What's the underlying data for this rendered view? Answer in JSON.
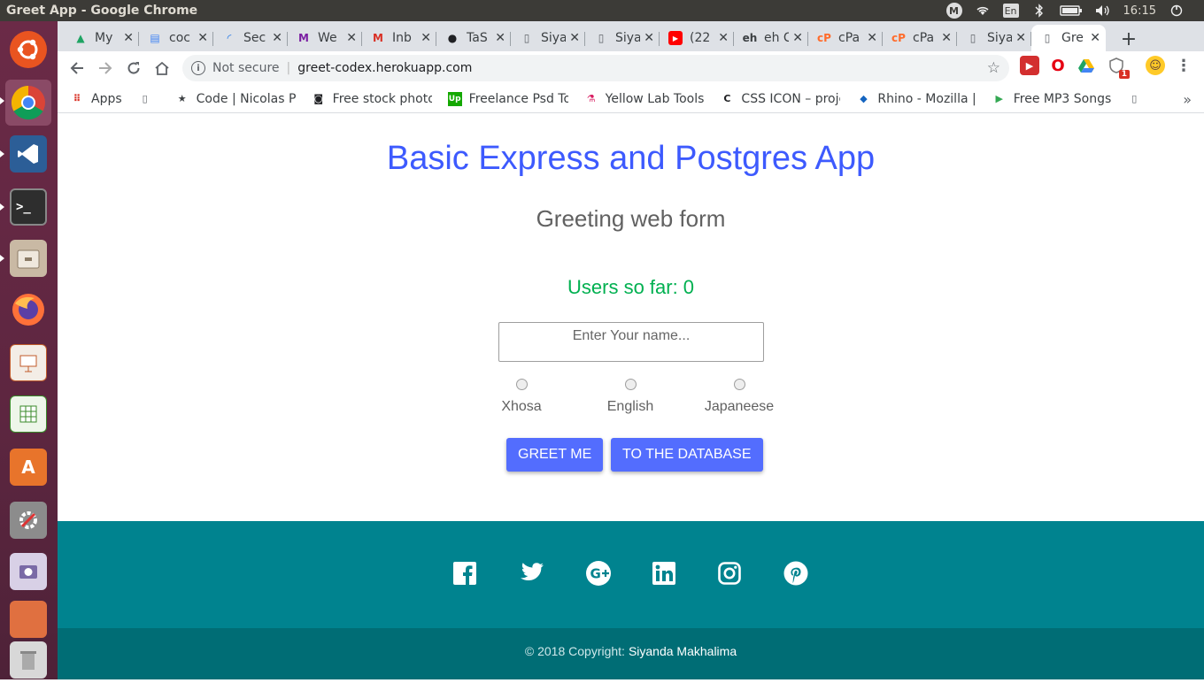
{
  "os": {
    "window_title": "Greet App - Google Chrome",
    "clock": "16:15",
    "keyboard_layout": "En",
    "tray_icons": [
      "mendeley-icon",
      "wifi-icon",
      "keyboard-icon",
      "bluetooth-icon",
      "battery-icon",
      "volume-icon"
    ],
    "launcher_apps": [
      "ubuntu-dash",
      "google-chrome",
      "vscode",
      "terminal",
      "files",
      "firefox",
      "libreoffice-impress",
      "libreoffice-calc",
      "software-center",
      "system-settings",
      "screenshot-tool",
      "trash"
    ]
  },
  "browser": {
    "tabs": [
      {
        "label": "My",
        "icon": "google-drive-icon",
        "color": "#1fa463"
      },
      {
        "label": "coc",
        "icon": "google-docs-icon",
        "color": "#4285f4"
      },
      {
        "label": "Sec",
        "icon": "loading-icon",
        "color": "#1a73e8"
      },
      {
        "label": "We",
        "icon": "m-logo-icon",
        "color": "#7b1fa2"
      },
      {
        "label": "Inb",
        "icon": "gmail-icon",
        "color": "#d93025"
      },
      {
        "label": "TaS",
        "icon": "github-icon",
        "color": "#202124"
      },
      {
        "label": "Siya",
        "icon": "page-icon",
        "color": "#5f6368"
      },
      {
        "label": "Siya",
        "icon": "page-icon",
        "color": "#5f6368"
      },
      {
        "label": "(22",
        "icon": "youtube-icon",
        "color": "#ff0000"
      },
      {
        "label": "eh Clie",
        "icon": "eh-icon",
        "color": "#3c4043"
      },
      {
        "label": "cPa",
        "icon": "cpanel-icon",
        "color": "#ff6c2c"
      },
      {
        "label": "cPa",
        "icon": "cpanel-icon",
        "color": "#ff6c2c"
      },
      {
        "label": "Siya",
        "icon": "page-icon",
        "color": "#5f6368"
      },
      {
        "label": "Gre",
        "icon": "page-icon",
        "color": "#5f6368",
        "active": true
      }
    ],
    "security_label": "Not secure",
    "url": "greet-codex.herokuapp.com",
    "extension_badge": "1",
    "bookmarks": [
      {
        "label": "Apps",
        "icon": "apps-grid-icon"
      },
      {
        "label": "",
        "icon": "page-icon"
      },
      {
        "label": "Code | Nicolas Pe",
        "icon": "code-star-icon"
      },
      {
        "label": "Free stock photo",
        "icon": "camera-icon"
      },
      {
        "label": "Freelance Psd To",
        "icon": "upwork-icon"
      },
      {
        "label": "Yellow Lab Tools",
        "icon": "flask-icon"
      },
      {
        "label": "CSS ICON – proje",
        "icon": "css-icon"
      },
      {
        "label": "Rhino - Mozilla | ",
        "icon": "rhino-icon"
      },
      {
        "label": "Free MP3 Songs",
        "icon": "play-store-icon"
      },
      {
        "label": "",
        "icon": "page-icon"
      }
    ],
    "bookmarks_more": "»"
  },
  "page": {
    "title": "Basic Express and Postgres App",
    "subtitle": "Greeting web form",
    "counter_label": "Users so far:",
    "counter_value": "0",
    "name_placeholder": "Enter Your name...",
    "languages": [
      "Xhosa",
      "English",
      "Japaneese"
    ],
    "greet_button": "GREET ME",
    "database_button": "TO THE DATABASE",
    "social_icons": [
      "facebook-icon",
      "twitter-icon",
      "google-plus-icon",
      "linkedin-icon",
      "instagram-icon",
      "pinterest-icon"
    ],
    "copyright": "© 2018 Copyright:",
    "author": "Siyanda Makhalima"
  },
  "colors": {
    "title": "#3d5afe",
    "counter": "#00b050",
    "button": "#536dfe",
    "footer": "#00838f",
    "footer_bottom": "#006d75"
  }
}
